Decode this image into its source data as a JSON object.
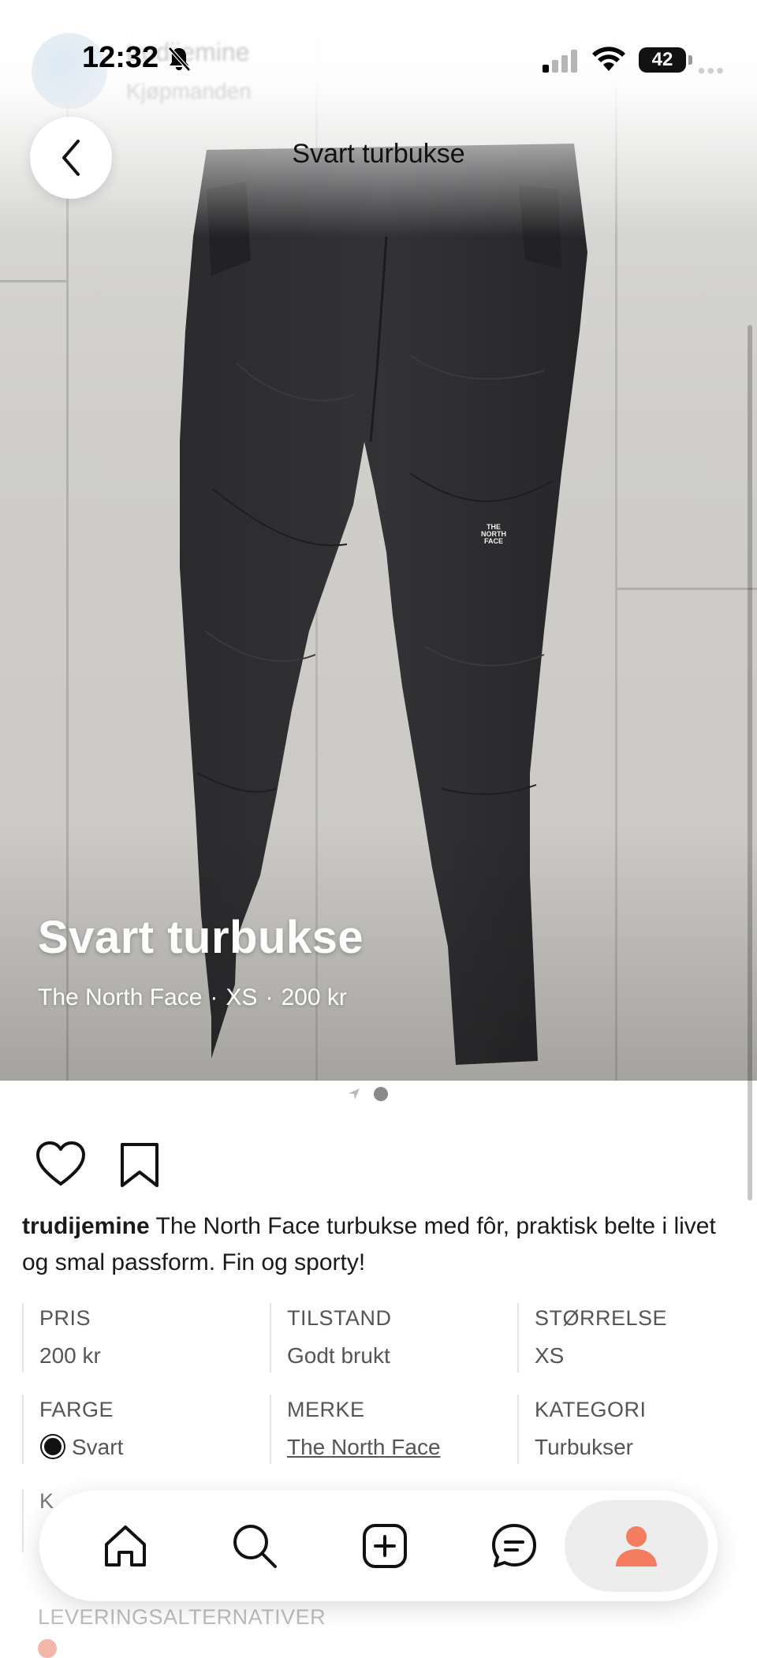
{
  "status_bar": {
    "time": "12:32",
    "battery": "42",
    "blurred_seller_name": "trudijemine",
    "blurred_seller_location": "Kjøpmanden"
  },
  "header": {
    "title": "Svart turbukse"
  },
  "hero": {
    "title": "Svart turbukse",
    "brand": "The North Face",
    "size": "XS",
    "price": "200 kr",
    "separator": "·",
    "logo_text": "THE NORTH FACE"
  },
  "carousel": {
    "total": 2,
    "current": 2
  },
  "post": {
    "username": "trudijemine",
    "description": " The North Face turbukse med fôr, praktisk belte i livet og smal passform. Fin og sporty!"
  },
  "attributes": [
    {
      "label": "PRIS",
      "value": "200 kr"
    },
    {
      "label": "TILSTAND",
      "value": "Godt brukt"
    },
    {
      "label": "STØRRELSE",
      "value": "XS"
    },
    {
      "label": "FARGE",
      "value": "Svart",
      "swatch": "#111111"
    },
    {
      "label": "MERKE",
      "value": "The North Face"
    },
    {
      "label": "KATEGORI",
      "value": "Turbukser"
    }
  ],
  "partial_attribute": {
    "label": "K"
  },
  "delivery": {
    "label": "LEVERINGSALTERNATIVER"
  },
  "tab_bar": {
    "items": [
      "home-icon",
      "search-icon",
      "add-icon",
      "messages-icon",
      "profile-icon"
    ],
    "active": "profile-icon"
  },
  "colors": {
    "accent": "#f47c5f",
    "text": "#1a1a1a",
    "muted": "#555555"
  }
}
